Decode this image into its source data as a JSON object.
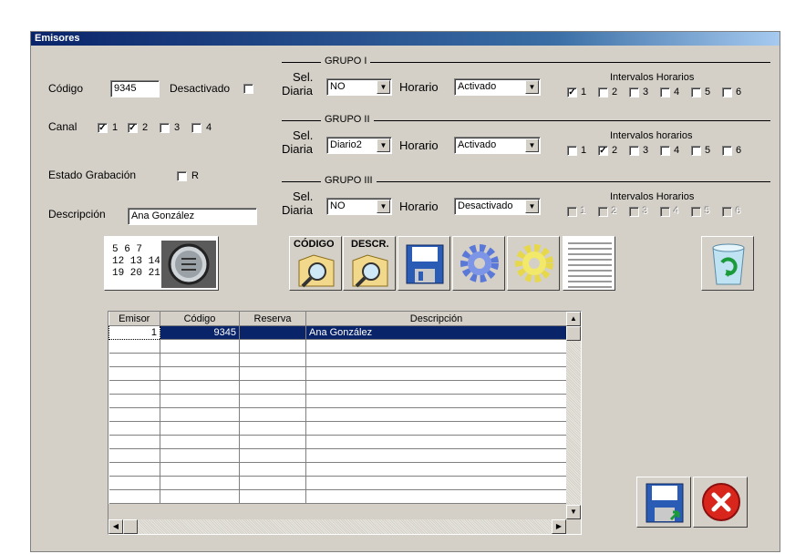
{
  "window": {
    "title": "Emisores"
  },
  "form": {
    "codigo_label": "Código",
    "codigo_value": "9345",
    "desactivado_label": "Desactivado",
    "canal_label": "Canal",
    "canal_options": [
      "1",
      "2",
      "3",
      "4"
    ],
    "canal_checked": [
      true,
      true,
      false,
      false
    ],
    "estado_label": "Estado Grabación",
    "estado_r_label": "R",
    "descripcion_label": "Descripción",
    "descripcion_value": "Ana González"
  },
  "grupos": [
    {
      "title": "GRUPO I",
      "sel_label_1": "Sel.",
      "sel_label_2": "Diaria",
      "sel_value": "NO",
      "horario_label": "Horario",
      "horario_value": "Activado",
      "intervalos_label": "Intervalos Horarios",
      "intervalos": [
        "1",
        "2",
        "3",
        "4",
        "5",
        "6"
      ],
      "checked": [
        true,
        false,
        false,
        false,
        false,
        false
      ],
      "disabled": false
    },
    {
      "title": "GRUPO II",
      "sel_label_1": "Sel.",
      "sel_label_2": "Diaria",
      "sel_value": "Diario2",
      "horario_label": "Horario",
      "horario_value": "Activado",
      "intervalos_label": "Intervalos horarios",
      "intervalos": [
        "1",
        "2",
        "3",
        "4",
        "5",
        "6"
      ],
      "checked": [
        false,
        true,
        false,
        false,
        false,
        false
      ],
      "disabled": false
    },
    {
      "title": "GRUPO III",
      "sel_label_1": "Sel.",
      "sel_label_2": "Diaria",
      "sel_value": "NO",
      "horario_label": "Horario",
      "horario_value": "Desactivado",
      "intervalos_label": "Intervalos Horarios",
      "intervalos": [
        "1",
        "2",
        "3",
        "4",
        "5",
        "6"
      ],
      "checked": [
        false,
        false,
        false,
        false,
        false,
        false
      ],
      "disabled": true
    }
  ],
  "toolbar": {
    "codigo_btn": "CÓDIGO",
    "descr_btn": "DESCR.",
    "calendar_numbers": [
      "5  6  7",
      "12 13 14",
      "19 20 21"
    ]
  },
  "table": {
    "columns": [
      "Emisor",
      "Código",
      "Reserva",
      "Descripción"
    ],
    "rows": [
      [
        "1",
        "9345",
        "",
        "Ana González"
      ]
    ],
    "empty_rows": 12
  }
}
